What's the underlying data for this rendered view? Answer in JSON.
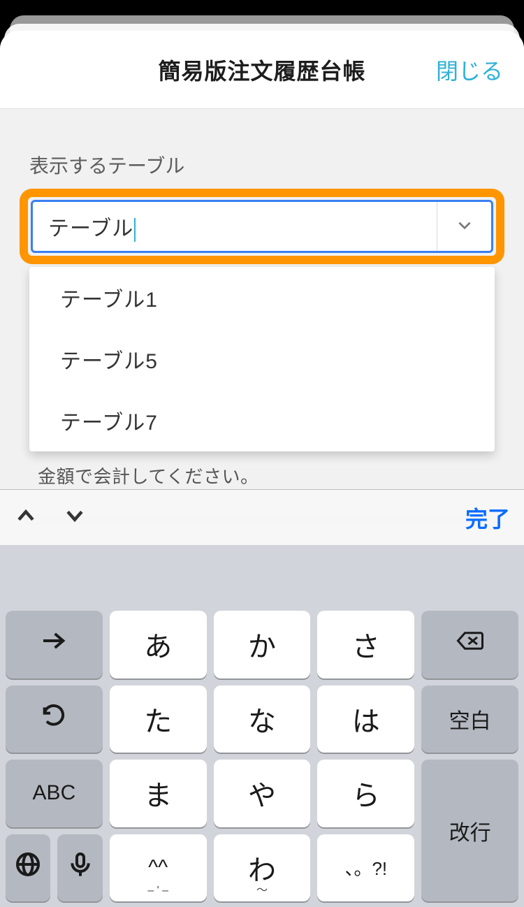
{
  "header": {
    "title": "簡易版注文履歴台帳",
    "close": "閉じる"
  },
  "field": {
    "label": "表示するテーブル",
    "input_value": "テーブル",
    "options": [
      "テーブル1",
      "テーブル5",
      "テーブル7"
    ]
  },
  "hint": "金額で会計してください。",
  "accessory": {
    "done": "完了"
  },
  "keyboard": {
    "rows": [
      [
        "→",
        "あ",
        "か",
        "さ",
        "⌫"
      ],
      [
        "↺",
        "た",
        "な",
        "は",
        "空白"
      ],
      [
        "ABC",
        "ま",
        "や",
        "ら",
        "改行"
      ],
      [
        "🌐/🎤",
        "^^",
        "わ",
        "、。?!",
        ""
      ]
    ],
    "space": "空白",
    "return": "改行",
    "abc": "ABC",
    "kao": "^^",
    "punct": "、。?!",
    "kana": {
      "a": "あ",
      "ka": "か",
      "sa": "さ",
      "ta": "た",
      "na": "な",
      "ha": "は",
      "ma": "ま",
      "ya": "や",
      "ra": "ら",
      "wa": "わ"
    }
  }
}
